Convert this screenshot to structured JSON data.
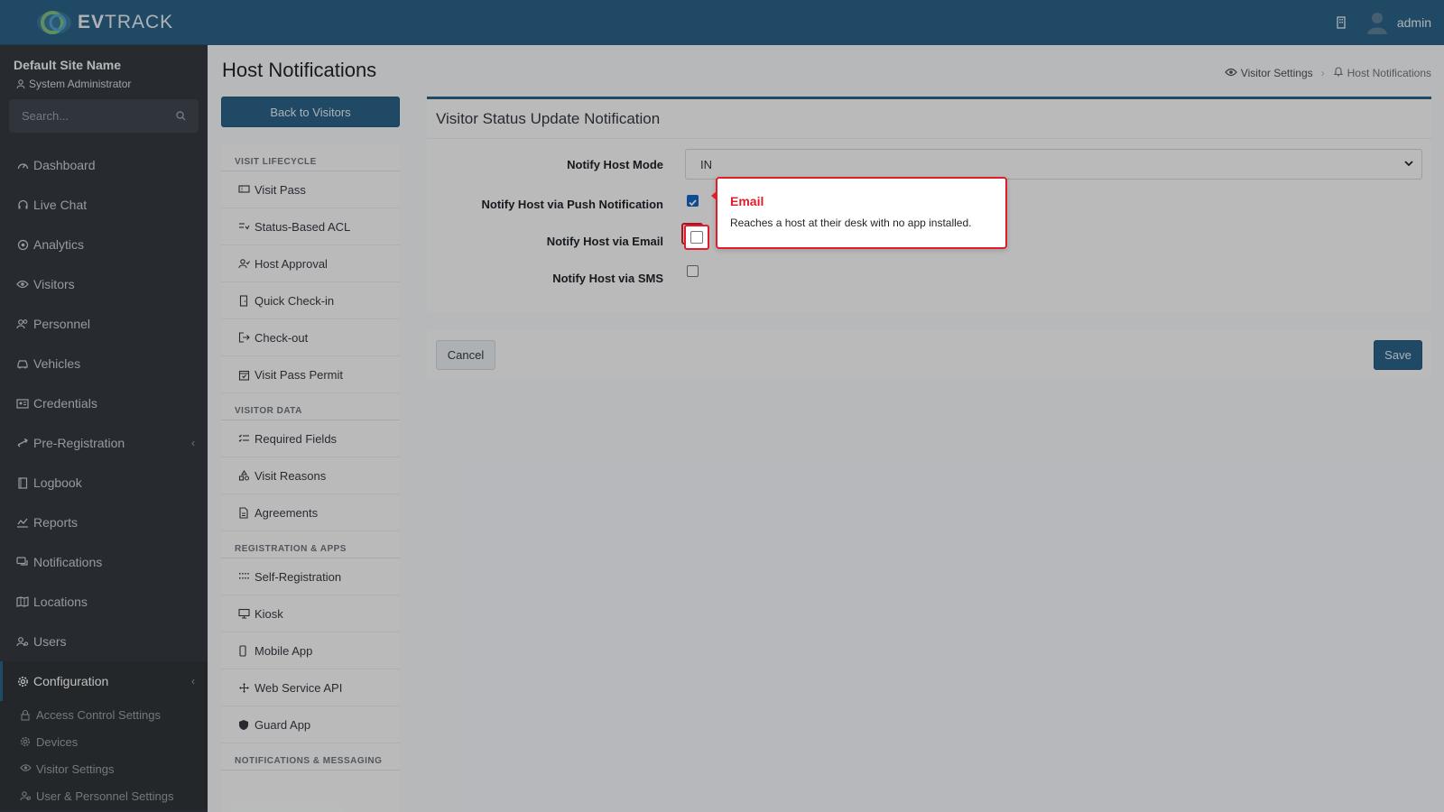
{
  "brand": {
    "name_bold": "EV",
    "name_rest": "TRACK"
  },
  "topbar": {
    "user_name": "admin",
    "icons": [
      "building-icon",
      "user-avatar-icon"
    ]
  },
  "sidebar": {
    "site_name": "Default Site Name",
    "role": "System Administrator",
    "search_placeholder": "Search...",
    "items": [
      {
        "label": "Dashboard",
        "icon": "dashboard-icon"
      },
      {
        "label": "Live Chat",
        "icon": "headset-icon"
      },
      {
        "label": "Analytics",
        "icon": "target-icon"
      },
      {
        "label": "Visitors",
        "icon": "eye-icon"
      },
      {
        "label": "Personnel",
        "icon": "users-icon"
      },
      {
        "label": "Vehicles",
        "icon": "car-icon"
      },
      {
        "label": "Credentials",
        "icon": "id-card-icon"
      },
      {
        "label": "Pre-Registration",
        "icon": "exchange-icon"
      },
      {
        "label": "Logbook",
        "icon": "book-icon"
      },
      {
        "label": "Reports",
        "icon": "chart-icon"
      },
      {
        "label": "Notifications",
        "icon": "comments-icon"
      },
      {
        "label": "Locations",
        "icon": "map-icon"
      },
      {
        "label": "Users",
        "icon": "user-gear-icon"
      },
      {
        "label": "Configuration",
        "icon": "gear-icon"
      }
    ],
    "subitems": [
      {
        "label": "Access Control Settings",
        "icon": "lock-icon"
      },
      {
        "label": "Devices",
        "icon": "cog-icon"
      },
      {
        "label": "Visitor Settings",
        "icon": "eye-icon"
      },
      {
        "label": "User & Personnel Settings",
        "icon": "users-icon"
      }
    ]
  },
  "page": {
    "title": "Host Notifications",
    "breadcrumb": {
      "parent": "Visitor Settings",
      "current": "Host Notifications"
    },
    "back_label": "Back to Visitors"
  },
  "subnav": {
    "sections": [
      {
        "header": "VISIT LIFECYCLE",
        "items": [
          "Visit Pass",
          "Status-Based ACL",
          "Host Approval",
          "Quick Check-in",
          "Check-out",
          "Visit Pass Permit"
        ]
      },
      {
        "header": "VISITOR DATA",
        "items": [
          "Required Fields",
          "Visit Reasons",
          "Agreements"
        ]
      },
      {
        "header": "REGISTRATION & APPS",
        "items": [
          "Self-Registration",
          "Kiosk",
          "Mobile App",
          "Web Service API",
          "Guard App"
        ]
      },
      {
        "header": "NOTIFICATIONS & MESSAGING",
        "items": []
      }
    ]
  },
  "card": {
    "title": "Visitor Status Update Notification",
    "mode_label": "Notify Host Mode",
    "mode_value": "IN",
    "push_label": "Notify Host via Push Notification",
    "push_checked": true,
    "email_label": "Notify Host via Email",
    "email_checked": false,
    "sms_label": "Notify Host via SMS",
    "sms_checked": false
  },
  "tooltip": {
    "title": "Email",
    "body": "Reaches a host at their desk with no app installed."
  },
  "actions": {
    "cancel": "Cancel",
    "save": "Save"
  },
  "colors": {
    "primary": "#2b6288",
    "sidebar": "#343a40",
    "highlight": "#e11d2b",
    "checked": "#1565c0"
  }
}
